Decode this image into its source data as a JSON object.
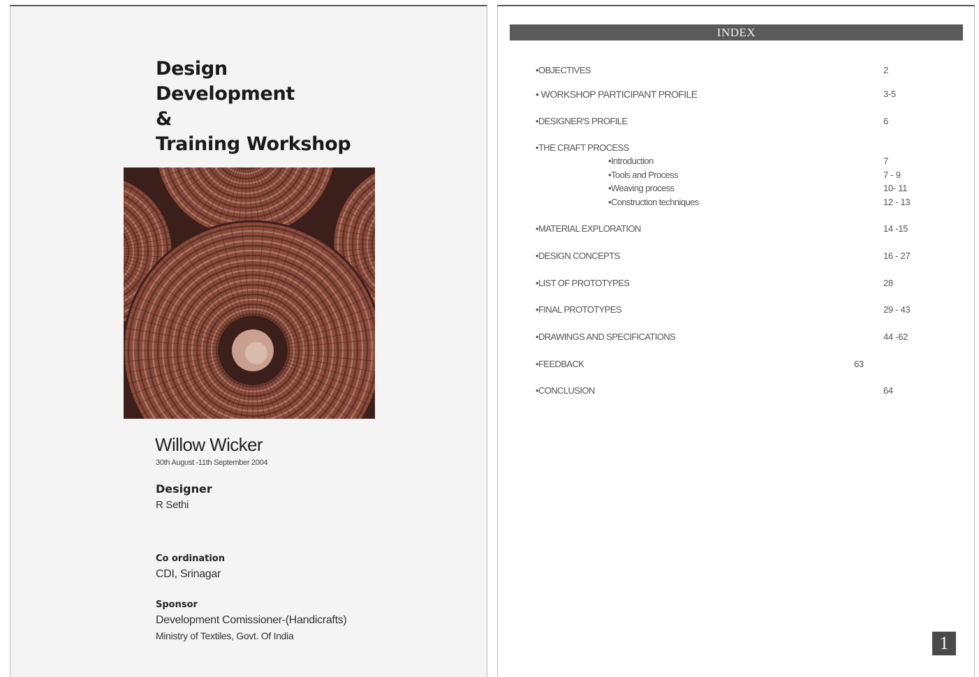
{
  "cover": {
    "title_lines": [
      "Design",
      "Development",
      "&",
      "Training Workshop"
    ],
    "craft_name": "Willow Wicker",
    "dates": "30th August -11th September 2004",
    "designer_label": "Designer",
    "designer_name": "R Sethi",
    "coordination_label": "Co ordination",
    "coordination_value": "CDI, Srinagar",
    "sponsor_label": "Sponsor",
    "sponsor_line1": "Development Comissioner-(Handicrafts)",
    "sponsor_line2": "Ministry of Textiles, Govt. Of India",
    "photo_colors": {
      "wicker": "#8a4a3a",
      "dark": "#3b1f1a",
      "light": "#c9a08f"
    }
  },
  "index": {
    "header": "INDEX",
    "entries": [
      {
        "label": "•OBJECTIVES",
        "page": "2"
      },
      {
        "label": "• WORKSHOP PARTICIPANT PROFILE",
        "page": "3-5"
      },
      {
        "label": "•DESIGNER'S PROFILE",
        "page": "6"
      },
      {
        "label": "•THE CRAFT PROCESS",
        "page": ""
      },
      {
        "label": "•Introduction",
        "page": "7"
      },
      {
        "label": "•Tools and Process",
        "page": "7 - 9"
      },
      {
        "label": "•Weaving process",
        "page": "10- 11"
      },
      {
        "label": "•Construction techniques",
        "page": "12 - 13"
      },
      {
        "label": "•MATERIAL EXPLORATION",
        "page": "14 -15"
      },
      {
        "label": "•DESIGN CONCEPTS",
        "page": "16 - 27"
      },
      {
        "label": "•LIST OF PROTOTYPES",
        "page": "28"
      },
      {
        "label": "•FINAL PROTOTYPES",
        "page": "29 - 43"
      },
      {
        "label": "•DRAWINGS AND SPECIFICATIONS",
        "page": "44 -62"
      },
      {
        "label": "•FEEDBACK",
        "page": "63"
      },
      {
        "label": "•CONCLUSION",
        "page": "64"
      }
    ],
    "page_number": "1"
  }
}
